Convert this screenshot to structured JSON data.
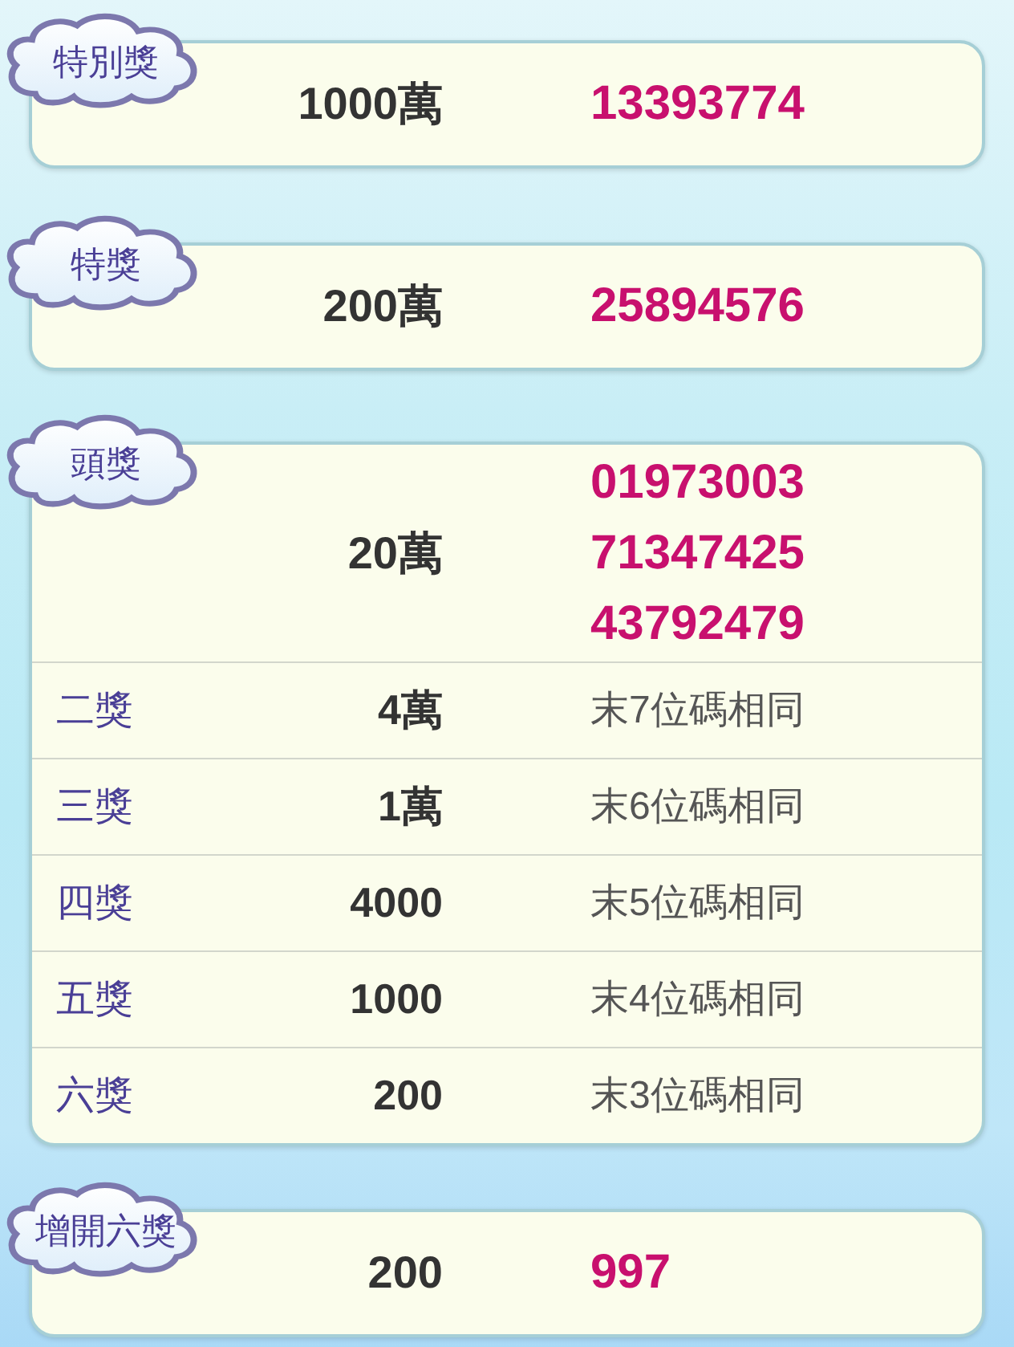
{
  "sections": [
    {
      "label": "特別獎",
      "prize": "1000萬",
      "numbers": [
        "13393774"
      ]
    },
    {
      "label": "特獎",
      "prize": "200萬",
      "numbers": [
        "25894576"
      ]
    },
    {
      "label": "頭獎",
      "prize": "20萬",
      "numbers": [
        "01973003",
        "71347425",
        "43792479"
      ],
      "rows": [
        {
          "label": "二獎",
          "prize": "4萬",
          "rule": "末7位碼相同"
        },
        {
          "label": "三獎",
          "prize": "1萬",
          "rule": "末6位碼相同"
        },
        {
          "label": "四獎",
          "prize": "4000",
          "rule": "末5位碼相同"
        },
        {
          "label": "五獎",
          "prize": "1000",
          "rule": "末4位碼相同"
        },
        {
          "label": "六獎",
          "prize": "200",
          "rule": "末3位碼相同"
        }
      ]
    },
    {
      "label": "增開六獎",
      "prize": "200",
      "numbers": [
        "997"
      ]
    }
  ]
}
